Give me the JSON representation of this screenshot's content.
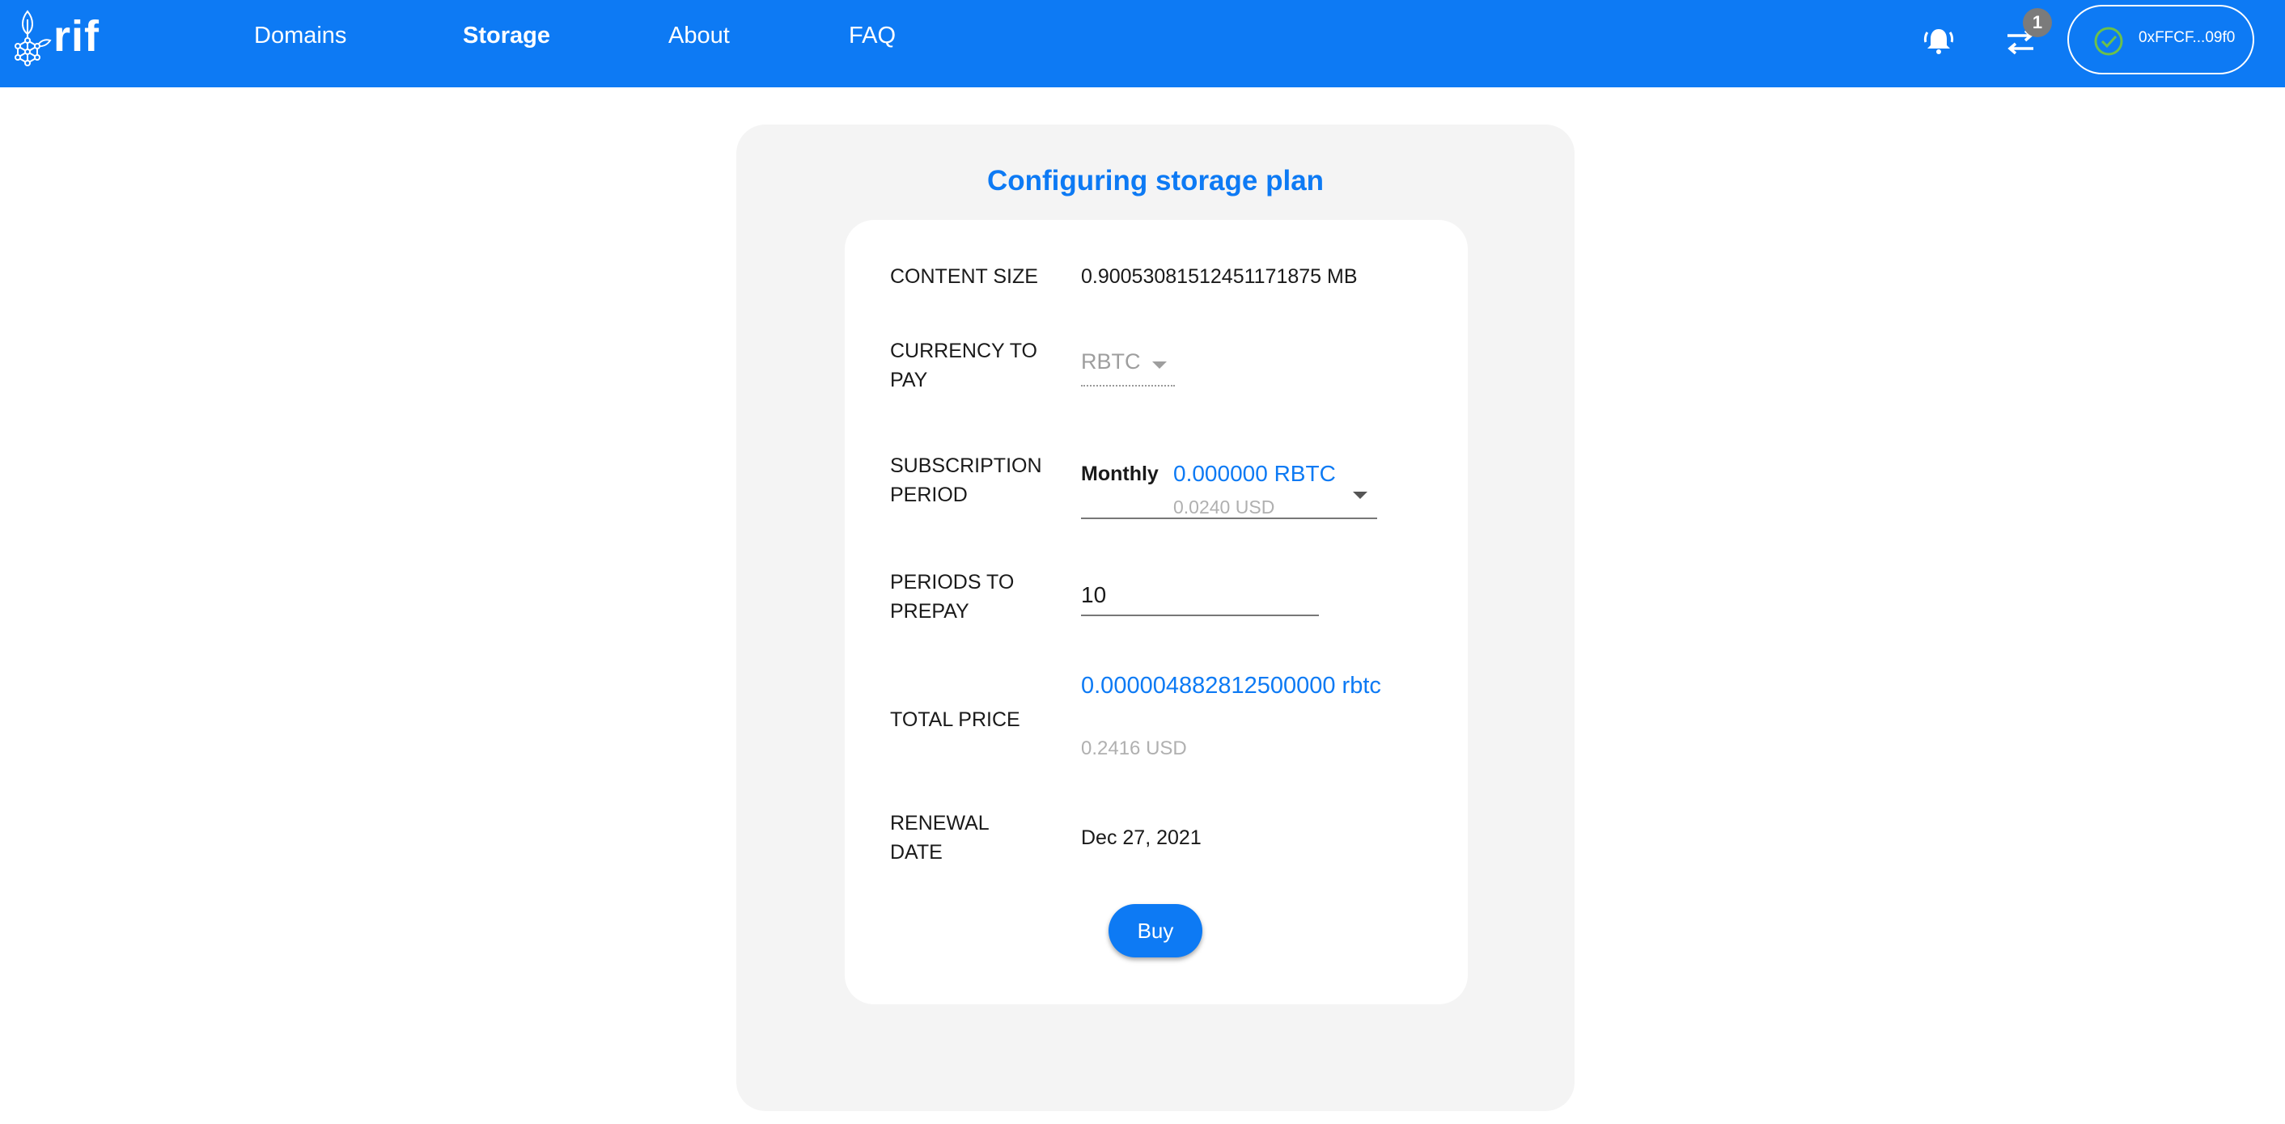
{
  "header": {
    "logo_text": "rif",
    "nav": [
      {
        "label": "Domains",
        "active": false
      },
      {
        "label": "Storage",
        "active": true
      },
      {
        "label": "About",
        "active": false
      },
      {
        "label": "FAQ",
        "active": false
      }
    ],
    "notifications_icon": "bell-icon",
    "transactions_icon": "swap-arrows-icon",
    "transactions_badge": "1",
    "account": {
      "status_icon": "check-circle-icon",
      "address": "0xFFCF...09f0"
    }
  },
  "colors": {
    "brand": "#0d7af4",
    "card_bg": "#f4f4f4",
    "muted": "#b0b0b0",
    "success": "#6cc04a"
  },
  "plan": {
    "title": "Configuring storage plan",
    "content_size": {
      "label": "CONTENT SIZE",
      "value": "0.90053081512451171875 MB"
    },
    "currency": {
      "label_1": "CURRENCY TO",
      "label_2": "PAY",
      "value": "RBTC"
    },
    "subscription": {
      "label_1": "SUBSCRIPTION",
      "label_2": "PERIOD",
      "period": "Monthly",
      "price_rbtc": "0.000000 RBTC",
      "price_usd": "0.0240 USD"
    },
    "periods": {
      "label_1": "PERIODS TO",
      "label_2": "PREPAY",
      "value": "10"
    },
    "total": {
      "label": "TOTAL PRICE",
      "rbtc": "0.000004882812500000 rbtc",
      "usd": "0.2416 USD"
    },
    "renewal": {
      "label_1": "RENEWAL",
      "label_2": "DATE",
      "value": "Dec 27, 2021"
    },
    "buy_label": "Buy"
  }
}
